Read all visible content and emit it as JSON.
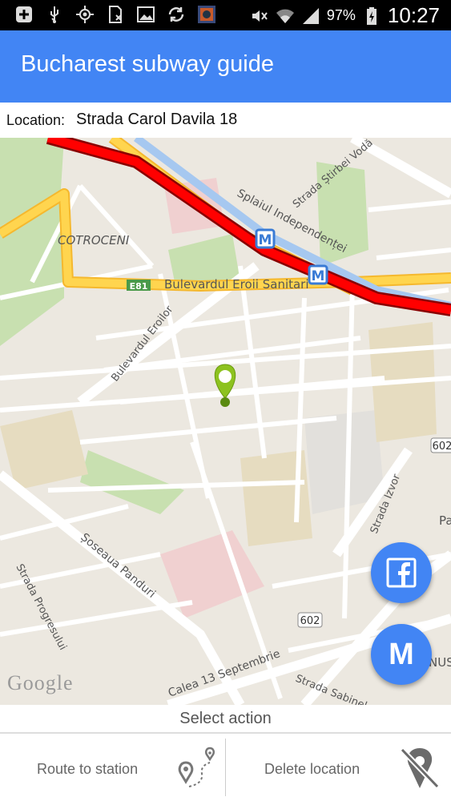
{
  "status_bar": {
    "battery_percent": "97%",
    "time": "10:27",
    "icons": [
      "add-icon",
      "usb-icon",
      "gps-icon",
      "sim-icon",
      "image-icon",
      "sync-icon",
      "app-thumbnail-icon",
      "mute-icon",
      "wifi-icon",
      "signal-icon",
      "battery-charging-icon"
    ]
  },
  "app_bar": {
    "title": "Bucharest subway guide"
  },
  "location": {
    "label": "Location:",
    "value": "Strada Carol Davila 18"
  },
  "map": {
    "labels": {
      "cotroceni": "COTROCENI",
      "e81": "E81",
      "bd_eroii_sanitari": "Bulevardul Eroii Sanitari",
      "splaiul": "Splaiul Independenței",
      "stirbei": "Strada Știrbei Vodă",
      "bd_eroilor": "Bulevardul Eroilor",
      "panduri": "Șoseaua Panduri",
      "progresului": "Strada Progresului",
      "calea13": "Calea 13 Septembrie",
      "sabinelor": "Strada Sabinelor",
      "izvor": "Strada Izvor",
      "route602a": "602",
      "route602b": "602",
      "pa": "Pa",
      "nus": "NUS",
      "metro_m1": "M",
      "metro_m2": "M"
    },
    "google": "Google",
    "colors": {
      "metro_line": "#ff0000",
      "metro_outline": "#8a0000",
      "main_road": "#ffd54f",
      "river": "#a6c8f0",
      "park": "#c8e0b0",
      "pin": "#8dc21f"
    }
  },
  "fab": {
    "facebook_icon": "facebook-icon",
    "metro_letter": "M"
  },
  "actions": {
    "title": "Select action",
    "route_label": "Route to station",
    "delete_label": "Delete location"
  }
}
